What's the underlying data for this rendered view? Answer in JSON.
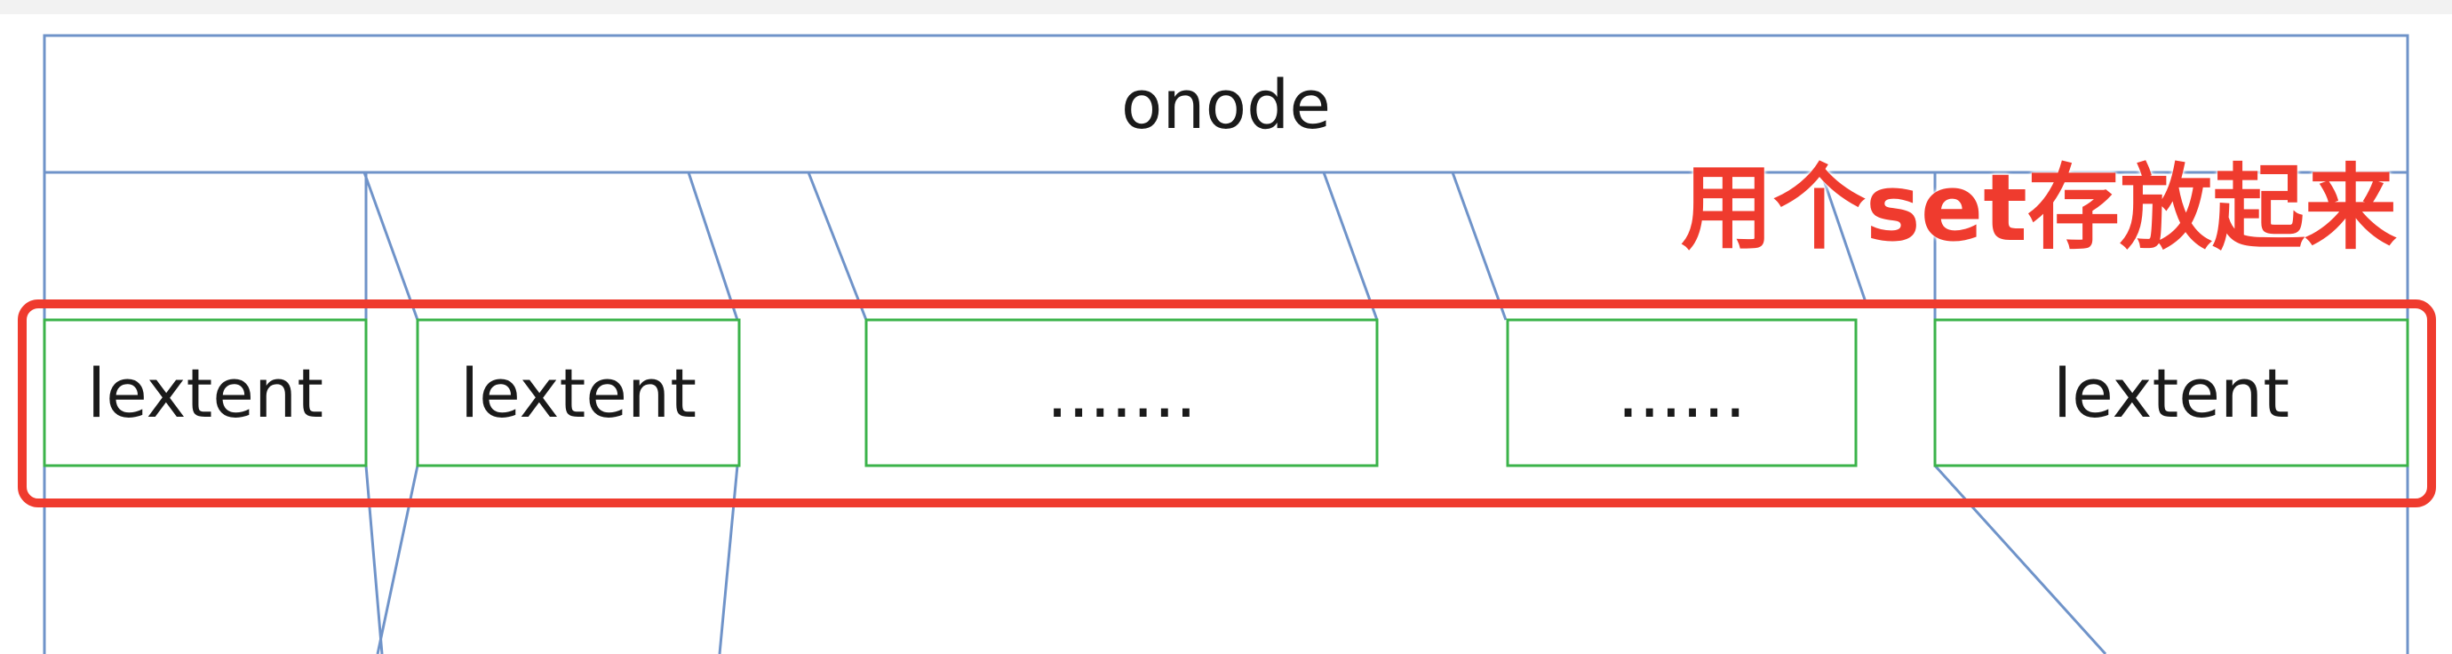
{
  "diagram": {
    "container_label": "onode",
    "annotation": "用个set存放起来",
    "boxes": [
      {
        "label": "lextent"
      },
      {
        "label": "lextent"
      },
      {
        "label": "......."
      },
      {
        "label": "......"
      },
      {
        "label": "lextent"
      }
    ]
  },
  "colors": {
    "outline": "#6f93c9",
    "box": "#3bb34a",
    "highlight": "#ef3b2e"
  }
}
